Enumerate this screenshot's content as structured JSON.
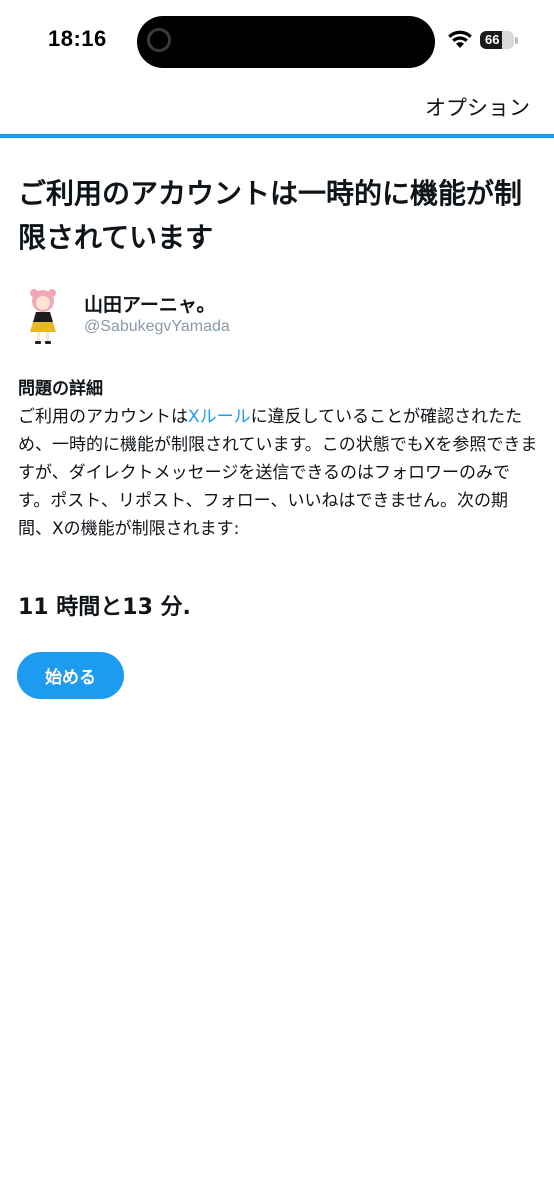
{
  "status_bar": {
    "time": "18:16",
    "battery_level": "66",
    "battery_fraction": 0.66
  },
  "header": {
    "options_label": "オプション",
    "accent_color": "#1d9bf0"
  },
  "main": {
    "title": "ご利用のアカウントは一時的に機能が制限されています",
    "user": {
      "name": "山田アーニャ。",
      "handle": "@SabukegvYamada"
    },
    "details_heading": "問題の詳細",
    "details_part1": "ご利用のアカウントは",
    "details_link": "Xルール",
    "details_part2": "に違反していることが確認されたため、一時的に機能が制限されています。この状態でもXを参照できますが、ダイレクトメッセージを送信できるのはフォロワーのみです。ポスト、リポスト、フォロー、いいねはできません。次の期間、Xの機能が制限されます:",
    "countdown": "11 時間と13 分.",
    "start_button": "始める"
  },
  "icons": {
    "wifi": "wifi-icon",
    "battery": "battery-icon",
    "camera": "camera-icon",
    "avatar": "avatar-image"
  }
}
